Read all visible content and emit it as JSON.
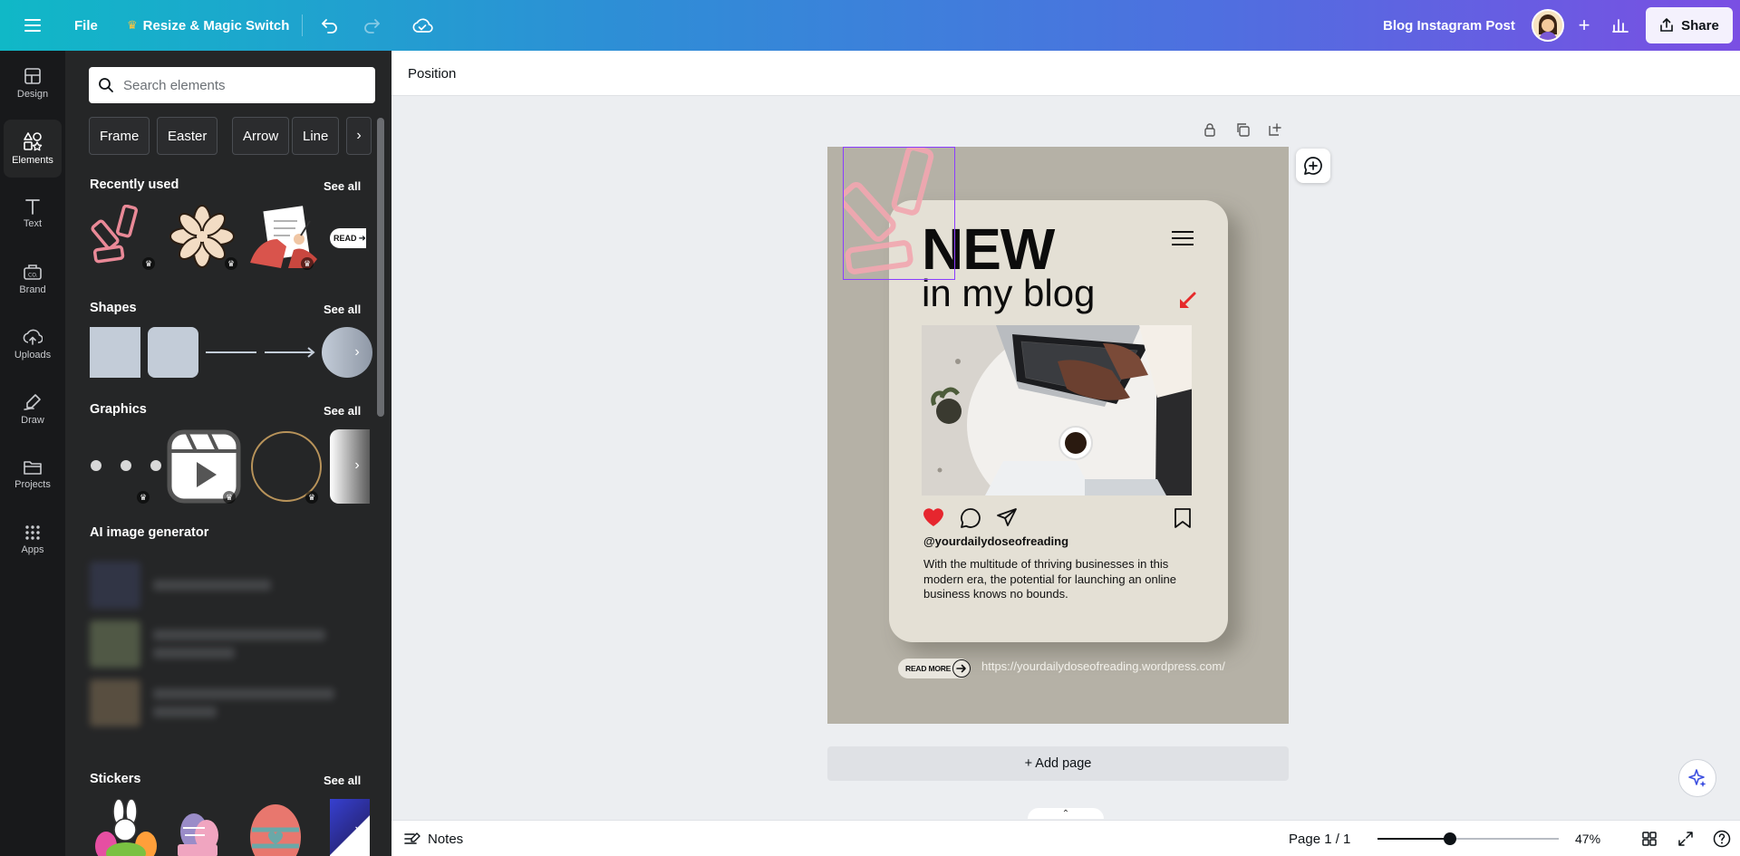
{
  "topbar": {
    "file_label": "File",
    "resize_label": "Resize & Magic Switch",
    "doc_title": "Blog Instagram Post",
    "share_label": "Share",
    "icons": [
      "menu-icon",
      "crown-icon",
      "undo-icon",
      "redo-icon",
      "cloud-save-icon",
      "plus-icon",
      "insights-icon",
      "share-icon"
    ]
  },
  "rail": {
    "items": [
      {
        "label": "Design",
        "icon": "design-icon"
      },
      {
        "label": "Elements",
        "icon": "elements-icon",
        "active": true
      },
      {
        "label": "Text",
        "icon": "text-icon"
      },
      {
        "label": "Brand",
        "icon": "brand-icon"
      },
      {
        "label": "Uploads",
        "icon": "upload-icon"
      },
      {
        "label": "Draw",
        "icon": "draw-icon"
      },
      {
        "label": "Projects",
        "icon": "folder-icon"
      },
      {
        "label": "Apps",
        "icon": "apps-icon"
      }
    ]
  },
  "panel": {
    "search_placeholder": "Search elements",
    "chips": [
      "Frame",
      "Easter",
      "Arrow",
      "Line"
    ],
    "sections": {
      "recently_used": "Recently used",
      "shapes": "Shapes",
      "graphics": "Graphics",
      "ai_generator": "AI image generator",
      "stickers": "Stickers"
    },
    "see_all": "See all",
    "read_more_thumb": "READ"
  },
  "context_bar": {
    "position_label": "Position"
  },
  "design": {
    "headline": "NEW",
    "subheadline": "in my blog",
    "handle": "@yourdailydoseofreading",
    "caption": "With the multitude of thriving businesses in this modern era, the potential for launching an online business knows no bounds.",
    "read_more": "READ MORE",
    "url": "https://yourdailydoseofreading.wordpress.com/",
    "colors": {
      "page_bg": "#b5b1a6",
      "card_bg": "#e4e0d5",
      "heart": "#e6262e",
      "accent_arrow": "#e62a2a",
      "decor": "#f2a7b0"
    }
  },
  "canvas": {
    "add_page_label": "+ Add page"
  },
  "bottombar": {
    "notes_label": "Notes",
    "page_label": "Page 1 / 1",
    "zoom_label": "47%",
    "zoom_level": 0.4
  }
}
